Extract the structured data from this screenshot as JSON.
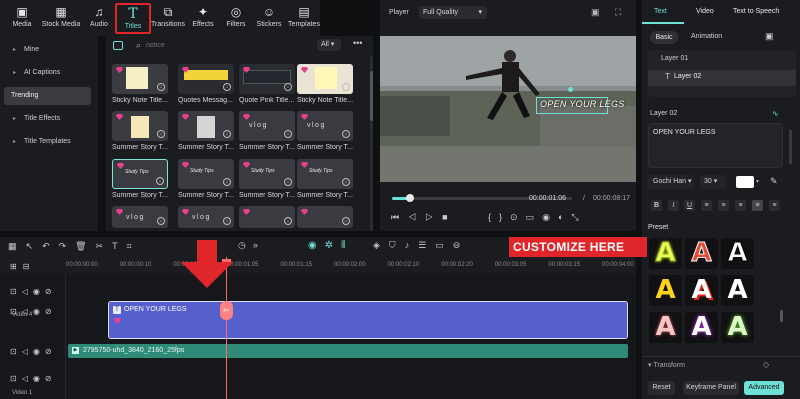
{
  "toolbar": {
    "items": [
      {
        "label": "Media",
        "icon": "media-icon"
      },
      {
        "label": "Stock Media",
        "icon": "stock-media-icon"
      },
      {
        "label": "Audio",
        "icon": "audio-icon"
      },
      {
        "label": "Titles",
        "icon": "titles-icon"
      },
      {
        "label": "Transitions",
        "icon": "transitions-icon"
      },
      {
        "label": "Effects",
        "icon": "effects-icon"
      },
      {
        "label": "Filters",
        "icon": "filters-icon"
      },
      {
        "label": "Stickers",
        "icon": "stickers-icon"
      },
      {
        "label": "Templates",
        "icon": "templates-icon"
      }
    ]
  },
  "leftnav": {
    "items": [
      "Mine",
      "AI Captions",
      "Trending",
      "Title Effects",
      "Title Templates"
    ]
  },
  "search": {
    "placeholder": "notice",
    "filter": "All"
  },
  "media": {
    "rows": [
      [
        "Sticky Note Title...",
        "Quotes Messag...",
        "Quote Pink Title...",
        "Sticky Note Title..."
      ],
      [
        "Summer Story T...",
        "Summer Story T...",
        "Summer Story T...",
        "Summer Story T..."
      ],
      [
        "Summer Story T...",
        "Summer Story T...",
        "Summer Story T...",
        "Summer Story T..."
      ],
      [
        "",
        "",
        "",
        ""
      ]
    ],
    "card_texts": [
      "Study Tips",
      "Study Tips",
      "vlog",
      "vlog"
    ]
  },
  "player": {
    "label": "Player",
    "quality": "Full Quality",
    "overlay_text": "OPEN YOUR LEGS",
    "time_current": "00:00:01:06",
    "time_total": "00:00:08:17"
  },
  "rpanel": {
    "tabs": [
      "Text",
      "Video",
      "Text to Speech"
    ],
    "subtabs": [
      "Basic",
      "Animation"
    ],
    "layers": [
      "Layer 01",
      "Layer 02"
    ],
    "layer_title": "Layer 02",
    "text_value": "OPEN YOUR LEGS",
    "font": "Gochi Han",
    "size": "30",
    "preset_label": "Preset",
    "transform_label": "Transform",
    "reset": "Reset",
    "keyframe": "Keyframe Panel",
    "advanced": "Advanced"
  },
  "timeline": {
    "ruler": [
      "00:00:00:00",
      "00:00:00:10",
      "00:00:00:20",
      "00:00:01:05",
      "00:00:01:15",
      "00:00:02:00",
      "00:00:02:10",
      "00:00:02:20",
      "00:00:03:05",
      "00:00:03:15",
      "00:00:04:00"
    ],
    "video4_label": "Video 4",
    "video1_label": "Video 1",
    "title_clip": "OPEN YOUR LEGS",
    "video_clip": "2795750-uhd_3840_2160_25fps",
    "customize": "CUSTOMIZE HERE"
  },
  "colors": {
    "accent": "#6fe0d4",
    "red": "#e1262b",
    "clip_blue": "#5560cc",
    "clip_green": "#2f8a78"
  }
}
